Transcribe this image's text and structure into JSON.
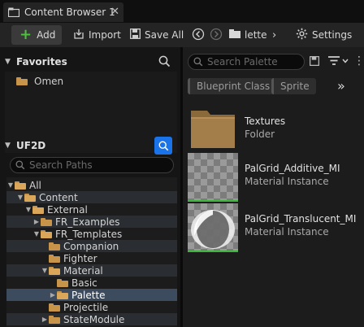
{
  "tab": {
    "title": "Content Browser 1",
    "close": "✕"
  },
  "toolbar": {
    "add_label": "Add",
    "import_label": "Import",
    "save_all_label": "Save All",
    "breadcrumb_current": "Palette",
    "breadcrumb_visible": "lette",
    "settings_label": "Settings"
  },
  "favorites": {
    "header": "Favorites",
    "items": [
      {
        "label": "Omen"
      }
    ]
  },
  "paths": {
    "header": "UF2D",
    "search_placeholder": "Search Paths",
    "tree": [
      {
        "label": "All",
        "expanded": true
      },
      {
        "label": "Content",
        "expanded": true
      },
      {
        "label": "External",
        "expanded": true
      },
      {
        "label": "FR_Examples",
        "expanded": false
      },
      {
        "label": "FR_Templates",
        "expanded": true
      },
      {
        "label": "Companion"
      },
      {
        "label": "Fighter"
      },
      {
        "label": "Material",
        "expanded": true
      },
      {
        "label": "Basic"
      },
      {
        "label": "Palette",
        "selected": true,
        "expanded": false
      },
      {
        "label": "Projectile"
      },
      {
        "label": "StateModule",
        "expanded": false
      }
    ]
  },
  "assets_panel": {
    "search_placeholder": "Search Palette",
    "filters": [
      "Blueprint Class",
      "Sprite"
    ],
    "assets": [
      {
        "name": "Textures",
        "type": "Folder"
      },
      {
        "name": "PalGrid_Additive_MI",
        "type": "Material Instance"
      },
      {
        "name": "PalGrid_Translucent_MI",
        "type": "Material Instance"
      }
    ]
  },
  "colors": {
    "accent_blue": "#1a73e8",
    "add_green": "#4fbf3f",
    "folder": "#c8944a",
    "material_instance_bar": "#3bb83b",
    "selection": "#3d4b5e"
  }
}
